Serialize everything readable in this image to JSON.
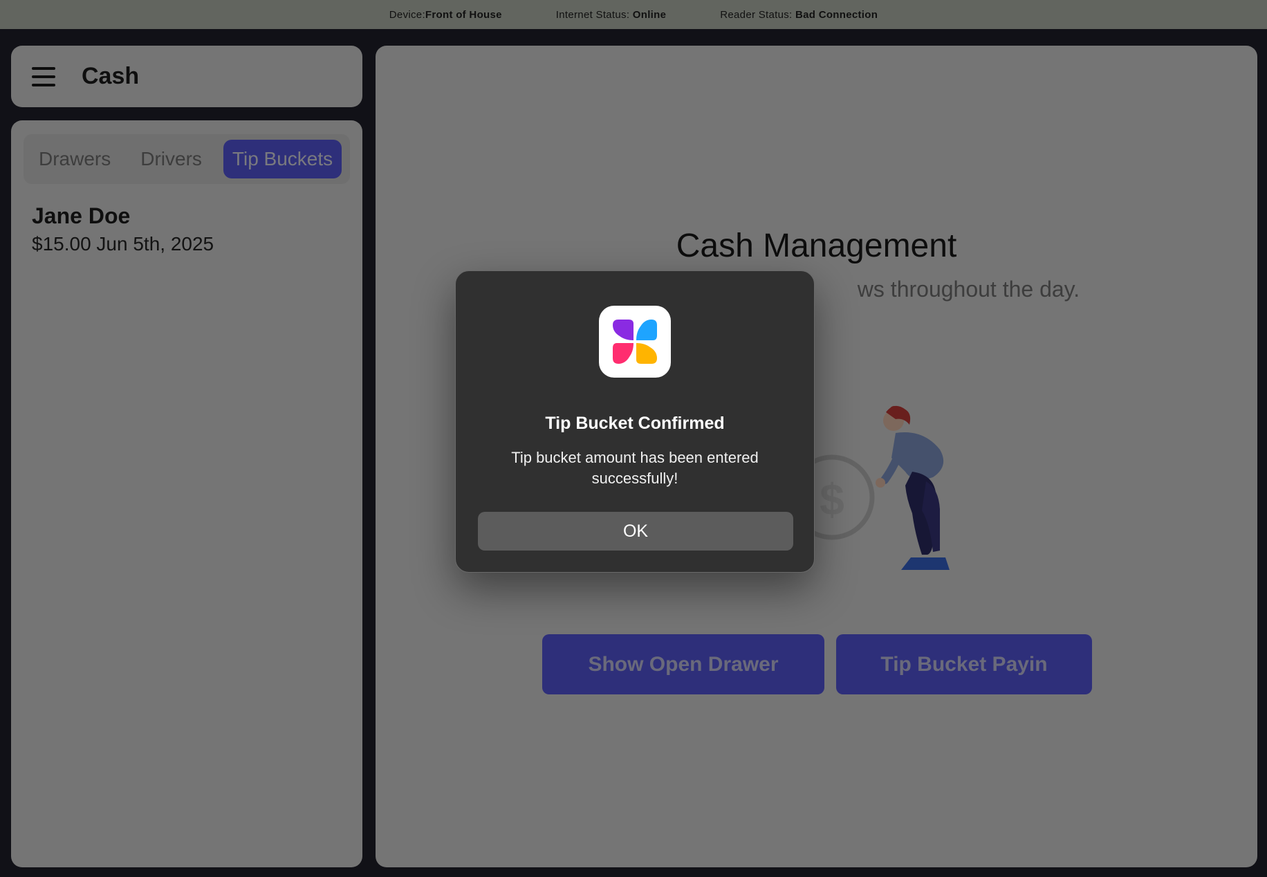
{
  "statusbar": {
    "device_label": "Device:",
    "device_value": "Front of House",
    "internet_label": "Internet Status:",
    "internet_value": "Online",
    "reader_label": "Reader Status:",
    "reader_value": "Bad Connection"
  },
  "header": {
    "title": "Cash",
    "menu_icon": "hamburger-menu-icon"
  },
  "tabs": [
    {
      "label": "Drawers",
      "active": false
    },
    {
      "label": "Drivers",
      "active": false
    },
    {
      "label": "Tip Buckets",
      "active": true
    }
  ],
  "tip_buckets": [
    {
      "name": "Jane Doe",
      "amount": "$15.00",
      "date": "Jun 5th, 2025"
    }
  ],
  "main": {
    "title": "Cash Management",
    "subtitle": "ws throughout the day.",
    "buttons": {
      "open_drawer": "Show Open Drawer",
      "tip_payin": "Tip Bucket Payin"
    }
  },
  "dialog": {
    "icon": "app-logo-icon",
    "title": "Tip Bucket Confirmed",
    "message": "Tip bucket amount has been entered successfully!",
    "ok": "OK"
  },
  "colors": {
    "accent": "#5d5ef5",
    "status_bar": "#c4cbbf",
    "dialog_bg": "#303030"
  }
}
